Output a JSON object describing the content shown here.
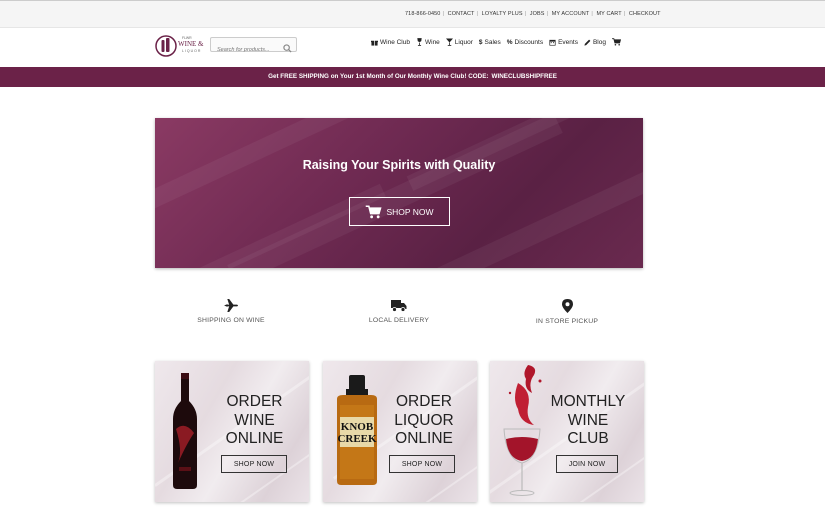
{
  "utility": {
    "phone": "718-866-0450",
    "links": [
      "CONTACT",
      "LOYALTY PLUS",
      "JOBS",
      "MY ACCOUNT",
      "MY CART",
      "CHECKOUT"
    ]
  },
  "header": {
    "logo_text_top": "FLWR",
    "logo_text_main": "WINE &",
    "logo_text_sub": "LIQUOR",
    "search_placeholder": "Search for products...",
    "nav": [
      {
        "label": "Wine Club",
        "icon": "gift-icon"
      },
      {
        "label": "Wine",
        "icon": "wine-glass-icon"
      },
      {
        "label": "Liquor",
        "icon": "cocktail-icon"
      },
      {
        "label": "Sales",
        "icon": "dollar-icon"
      },
      {
        "label": "Discounts",
        "icon": "percent-icon"
      },
      {
        "label": "Events",
        "icon": "calendar-icon"
      },
      {
        "label": "Blog",
        "icon": "pencil-icon"
      }
    ]
  },
  "promo": {
    "text": "Get FREE SHIPPING on Your 1st Month of Our Monthly Wine Club!  CODE:",
    "code": "WINECLUBSHIPFREE"
  },
  "hero": {
    "title": "Raising Your Spirits with Quality",
    "button": "SHOP NOW"
  },
  "features": [
    {
      "label": "SHIPPING ON WINE",
      "icon": "airplane-icon"
    },
    {
      "label": "LOCAL DELIVERY",
      "icon": "truck-icon"
    },
    {
      "label": "IN STORE PICKUP",
      "icon": "map-marker-icon"
    }
  ],
  "cards": [
    {
      "lines": [
        "ORDER",
        "WINE",
        "ONLINE"
      ],
      "button": "SHOP NOW"
    },
    {
      "lines": [
        "ORDER",
        "LIQUOR",
        "ONLINE"
      ],
      "button": "SHOP NOW",
      "bottle_label": [
        "KNOB",
        "CREEK"
      ]
    },
    {
      "lines": [
        "MONTHLY",
        "WINE",
        "CLUB"
      ],
      "button": "JOIN NOW"
    }
  ],
  "colors": {
    "brand": "#6b2248",
    "hero": "#6f2a52",
    "utility_bg": "#f5f5f5"
  }
}
